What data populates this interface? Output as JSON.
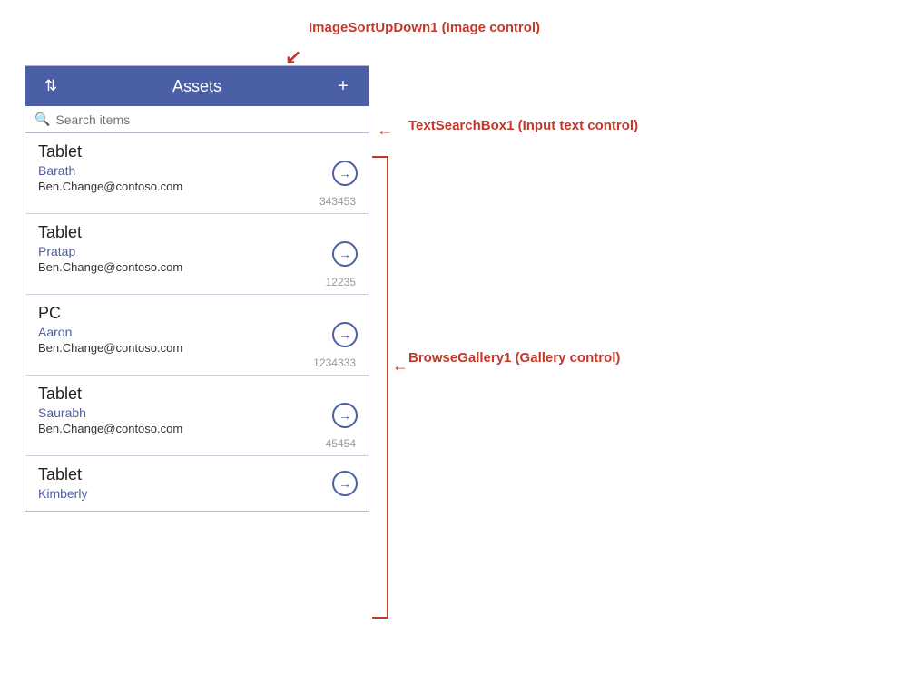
{
  "header": {
    "title": "Assets",
    "sort_icon": "⇅",
    "add_icon": "+"
  },
  "search": {
    "placeholder": "Search items"
  },
  "gallery_items": [
    {
      "title": "Tablet",
      "subtitle": "Barath",
      "email": "Ben.Change@contoso.com",
      "id": "343453"
    },
    {
      "title": "Tablet",
      "subtitle": "Pratap",
      "email": "Ben.Change@contoso.com",
      "id": "12235"
    },
    {
      "title": "PC",
      "subtitle": "Aaron",
      "email": "Ben.Change@contoso.com",
      "id": "1234333"
    },
    {
      "title": "Tablet",
      "subtitle": "Saurabh",
      "email": "Ben.Change@contoso.com",
      "id": "45454"
    },
    {
      "title": "Tablet",
      "subtitle": "Kimberly",
      "email": "",
      "id": ""
    }
  ],
  "annotations": {
    "sort_label": "ImageSortUpDown1 (Image control)",
    "search_label": "TextSearchBox1 (Input text control)",
    "gallery_label": "BrowseGallery1 (Gallery control)"
  }
}
